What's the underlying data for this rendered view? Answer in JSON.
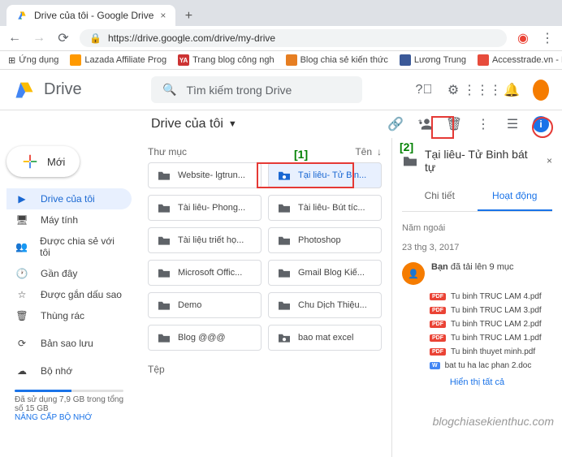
{
  "browser": {
    "tab_title": "Drive của tôi - Google Drive",
    "url": "https://drive.google.com/drive/my-drive",
    "bookmarks_label": "Ứng dụng",
    "bookmarks": [
      "Lazada Affiliate Prog",
      "Trang blog công ngh",
      "Blog chia sẻ kiến thức",
      "Lương Trung",
      "Accesstrade.vn - H"
    ]
  },
  "drive": {
    "title": "Drive",
    "search_placeholder": "Tìm kiếm trong Drive",
    "new_label": "Mới",
    "sidebar": [
      {
        "label": "Drive của tôi"
      },
      {
        "label": "Máy tính"
      },
      {
        "label": "Được chia sẻ với tôi"
      },
      {
        "label": "Gần đây"
      },
      {
        "label": "Được gắn dấu sao"
      },
      {
        "label": "Thùng rác"
      },
      {
        "label": "Bản sao lưu"
      },
      {
        "label": "Bộ nhớ"
      }
    ],
    "storage_text": "Đã sử dụng 7,9 GB trong tổng số 15 GB",
    "upgrade": "NÂNG CẤP BỘ NHỚ"
  },
  "content": {
    "breadcrumb": "Drive của tôi",
    "section_folders": "Thư mục",
    "section_files": "Tệp",
    "sort_label": "Tên",
    "folders": [
      {
        "label": "Website- lgtrun..."
      },
      {
        "label": "Tại liêu- Tử Bin..."
      },
      {
        "label": "Tài liêu- Phong..."
      },
      {
        "label": "Tài liêu- Bút tíc..."
      },
      {
        "label": "Tài liệu triết họ..."
      },
      {
        "label": "Photoshop"
      },
      {
        "label": "Microsoft Offic..."
      },
      {
        "label": "Gmail Blog Kiế..."
      },
      {
        "label": "Demo"
      },
      {
        "label": "Chu Dịch Thiệu..."
      },
      {
        "label": "Blog @@@"
      },
      {
        "label": "bao mat excel"
      }
    ]
  },
  "details": {
    "title": "Tại liêu- Tử Binh bát tự",
    "tab_detail": "Chi tiết",
    "tab_activity": "Hoạt động",
    "year": "Năm ngoái",
    "date": "23 thg 3, 2017",
    "actor": "Bạn",
    "action": "đã tải lên 9 mục",
    "files": [
      {
        "badge": "PDF",
        "name": "Tu binh TRUC LAM 4.pdf"
      },
      {
        "badge": "PDF",
        "name": "Tu binh TRUC LAM 3.pdf"
      },
      {
        "badge": "PDF",
        "name": "Tu binh TRUC LAM 2.pdf"
      },
      {
        "badge": "PDF",
        "name": "Tu binh TRUC LAM 1.pdf"
      },
      {
        "badge": "PDF",
        "name": "Tu binh thuyet minh.pdf"
      },
      {
        "badge": "W",
        "name": "bat tu ha lac phan 2.doc"
      }
    ],
    "show_all": "Hiển thị tất cả"
  },
  "annotations": {
    "a1": "[1]",
    "a2": "[2]"
  },
  "watermark": "blogchiasekienthuc.com"
}
